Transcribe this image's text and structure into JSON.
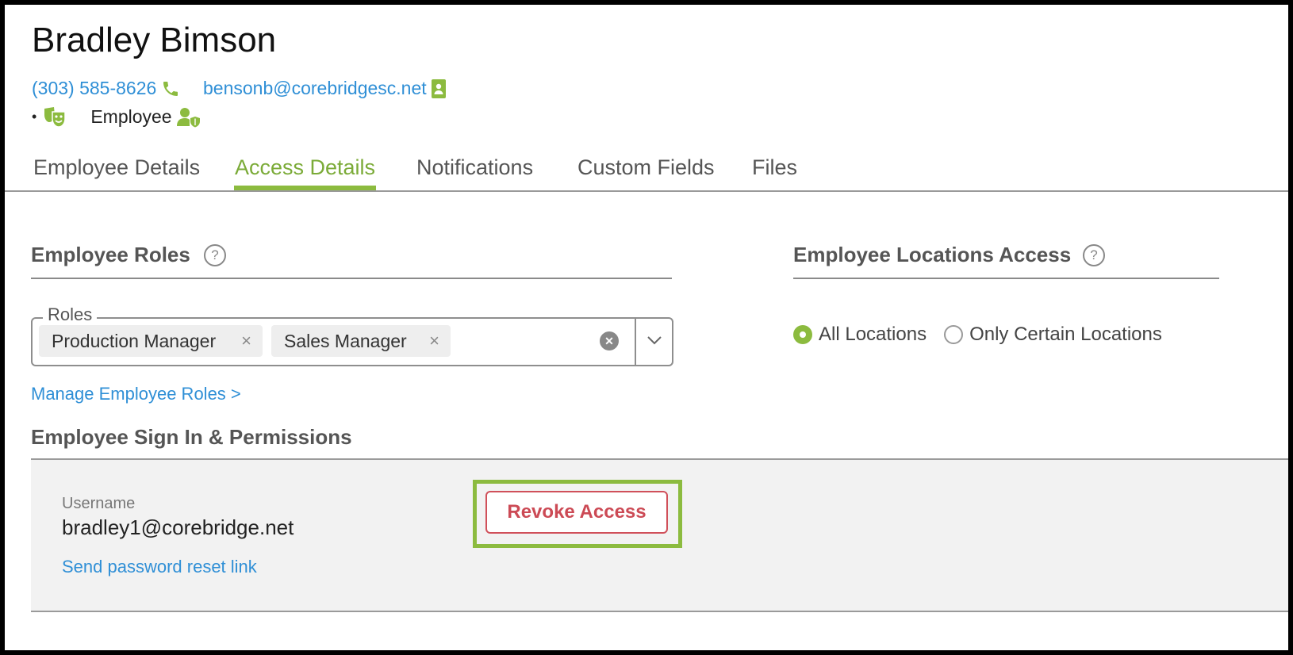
{
  "header": {
    "name": "Bradley Bimson",
    "phone": "(303) 585-8626",
    "email": "bensonb@corebridgesc.net",
    "bullet": "•",
    "role": "Employee"
  },
  "tabs": [
    {
      "label": "Employee Details",
      "active": false
    },
    {
      "label": "Access Details",
      "active": true
    },
    {
      "label": "Notifications",
      "active": false
    },
    {
      "label": "Custom Fields",
      "active": false
    },
    {
      "label": "Files",
      "active": false
    }
  ],
  "roles_section": {
    "title": "Employee Roles",
    "help": "?",
    "field_label": "Roles",
    "selected": [
      "Production Manager",
      "Sales Manager"
    ],
    "remove_glyph": "×",
    "manage_link": "Manage Employee Roles >"
  },
  "locations_section": {
    "title": "Employee Locations Access",
    "help": "?",
    "options": [
      {
        "label": "All Locations",
        "selected": true
      },
      {
        "label": "Only Certain Locations",
        "selected": false
      }
    ]
  },
  "signin_section": {
    "title": "Employee Sign In & Permissions",
    "username_label": "Username",
    "username": "bradley1@corebridge.net",
    "reset_link": "Send password reset link",
    "revoke_button": "Revoke Access"
  },
  "colors": {
    "accent": "#8cbb3f",
    "link": "#2f8fd6",
    "danger": "#cc4a55"
  }
}
